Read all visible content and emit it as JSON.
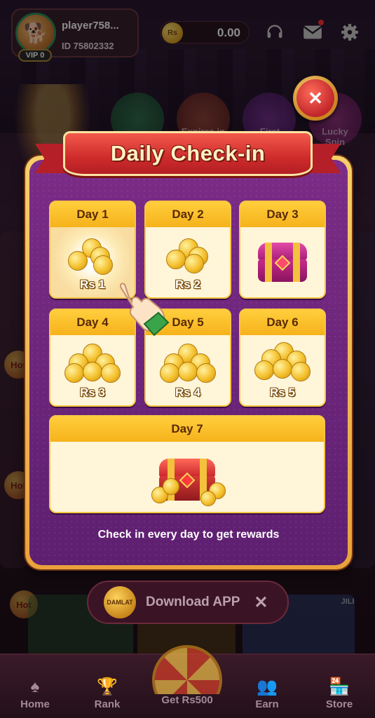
{
  "header": {
    "player_name": "player758...",
    "player_id": "ID 75802332",
    "vip_label": "VIP 0",
    "balance_currency": "Rs",
    "balance": "0.00"
  },
  "background": {
    "tiles": [
      "Expires in",
      "First",
      "Lucky Spin"
    ],
    "hot_label": "Hot",
    "jili_label": "JILI"
  },
  "modal": {
    "title": "Daily Check-in",
    "close_icon": "close-icon",
    "note": "Check in every day to get rewards",
    "days": [
      {
        "label": "Day 1",
        "reward": "Rs 1",
        "icon": "coins-stack",
        "claimable": true
      },
      {
        "label": "Day 2",
        "reward": "Rs 2",
        "icon": "coins-stack"
      },
      {
        "label": "Day 3",
        "reward": "",
        "icon": "treasure-chest-pink"
      },
      {
        "label": "Day 4",
        "reward": "Rs 3",
        "icon": "coins-pile"
      },
      {
        "label": "Day 5",
        "reward": "Rs 4",
        "icon": "coins-pile"
      },
      {
        "label": "Day 6",
        "reward": "Rs 5",
        "icon": "coins-pile"
      },
      {
        "label": "Day 7",
        "reward": "",
        "icon": "treasure-chest-red"
      }
    ]
  },
  "download_bar": {
    "logo_text": "DAMLAT",
    "label": "Download APP"
  },
  "bottom_nav": {
    "items": [
      {
        "label": "Home",
        "icon": "spade-icon"
      },
      {
        "label": "Rank",
        "icon": "trophy-icon"
      },
      {
        "label": "Get Rs500",
        "icon": "wheel-icon"
      },
      {
        "label": "Earn",
        "icon": "users-icon"
      },
      {
        "label": "Store",
        "icon": "store-icon"
      }
    ]
  },
  "colors": {
    "modal_purple": "#6a2478",
    "gold": "#f6b21b",
    "banner_red": "#cf2b2b",
    "card_cream": "#fff5d9"
  }
}
